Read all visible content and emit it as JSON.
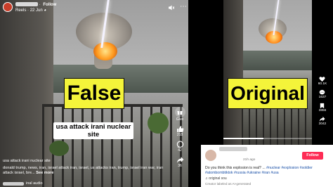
{
  "left": {
    "header": {
      "page_label": "Reels",
      "date": "22 Jun",
      "follow_label": "Follow"
    },
    "overlay_label": "False",
    "caption": "usa attack irani nuclear site",
    "actions": [
      {
        "icon": "gift-icon",
        "label": "Give"
      },
      {
        "icon": "like-icon",
        "label": "218"
      },
      {
        "icon": "comment-icon",
        "label": "42"
      },
      {
        "icon": "share-icon",
        "label": "36"
      }
    ],
    "post_title": "usa attack irani nuclear site",
    "post_tags": "donald trump, news, iran, israel attack iran, israel, us attacks iran, trump, israel iran war, iran attack israel, bre...",
    "see_more": "See more",
    "audio_label": "inal audio",
    "colors": {
      "label_bg": "#f4f43a"
    }
  },
  "right": {
    "overlay_label": "Original",
    "rail": [
      {
        "icon": "heart-icon",
        "label": "60.1K"
      },
      {
        "icon": "comment-icon",
        "label": "1637"
      },
      {
        "icon": "bookmark-icon",
        "label": "3856"
      },
      {
        "icon": "share-icon",
        "label": "3042"
      }
    ],
    "progress": 0.45,
    "time_ago": "21h ago",
    "follow_label": "Follow",
    "description": "Do you think this explosion is real? ... ",
    "hashtags": "#nuclear #explosion #soldier #atombombtiktok #russia #ukraine #iran #usa",
    "sound": "original sou",
    "note": "Creator labeled as AI-generated",
    "colors": {
      "follow_bg": "#fe2c55",
      "hashtag": "#1a50a8"
    }
  }
}
